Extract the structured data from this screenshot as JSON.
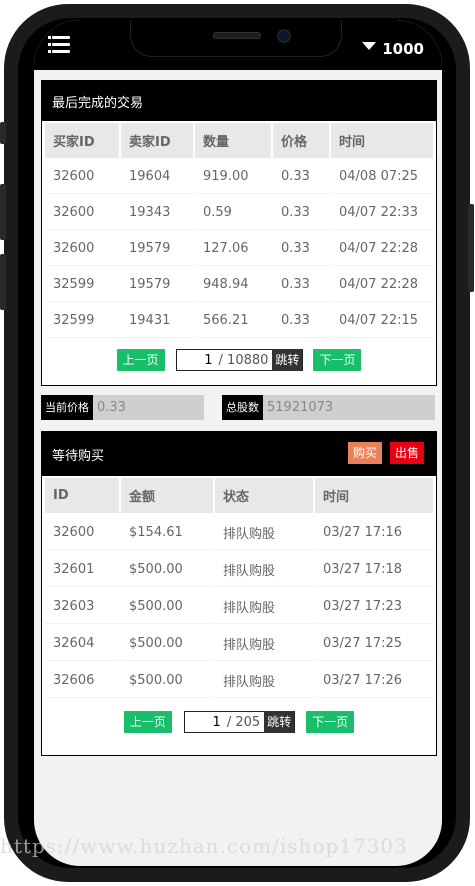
{
  "header": {
    "balance": "1000"
  },
  "trades": {
    "title": "最后完成的交易",
    "columns": [
      "买家ID",
      "卖家ID",
      "数量",
      "价格",
      "时间"
    ],
    "rows": [
      [
        "32600",
        "19604",
        "919.00",
        "0.33",
        "04/08 07:25"
      ],
      [
        "32600",
        "19343",
        "0.59",
        "0.33",
        "04/07 22:33"
      ],
      [
        "32600",
        "19579",
        "127.06",
        "0.33",
        "04/07 22:28"
      ],
      [
        "32599",
        "19579",
        "948.94",
        "0.33",
        "04/07 22:28"
      ],
      [
        "32599",
        "19431",
        "566.21",
        "0.33",
        "04/07 22:15"
      ]
    ],
    "pager": {
      "prev": "上一页",
      "page": "1",
      "total": "/ 10880",
      "jump": "跳转",
      "next": "下一页"
    }
  },
  "stats": {
    "price_label": "当前价格",
    "price_value": "0.33",
    "shares_label": "总股数",
    "shares_value": "51921073"
  },
  "pending": {
    "title": "等待购买",
    "buy_label": "购买",
    "sell_label": "出售",
    "columns": [
      "ID",
      "金额",
      "状态",
      "时间"
    ],
    "rows": [
      [
        "32600",
        "$154.61",
        "排队购股",
        "03/27 17:16"
      ],
      [
        "32601",
        "$500.00",
        "排队购股",
        "03/27 17:18"
      ],
      [
        "32603",
        "$500.00",
        "排队购股",
        "03/27 17:23"
      ],
      [
        "32604",
        "$500.00",
        "排队购股",
        "03/27 17:25"
      ],
      [
        "32606",
        "$500.00",
        "排队购股",
        "03/27 17:26"
      ]
    ],
    "pager": {
      "prev": "上一页",
      "page": "1",
      "total": "/ 205",
      "jump": "跳转",
      "next": "下一页"
    }
  },
  "colors": {
    "green": "#19be6b",
    "buy": "#e8825a",
    "sell": "#e60012"
  },
  "watermark": "https://www.huzhan.com/ishop17303"
}
